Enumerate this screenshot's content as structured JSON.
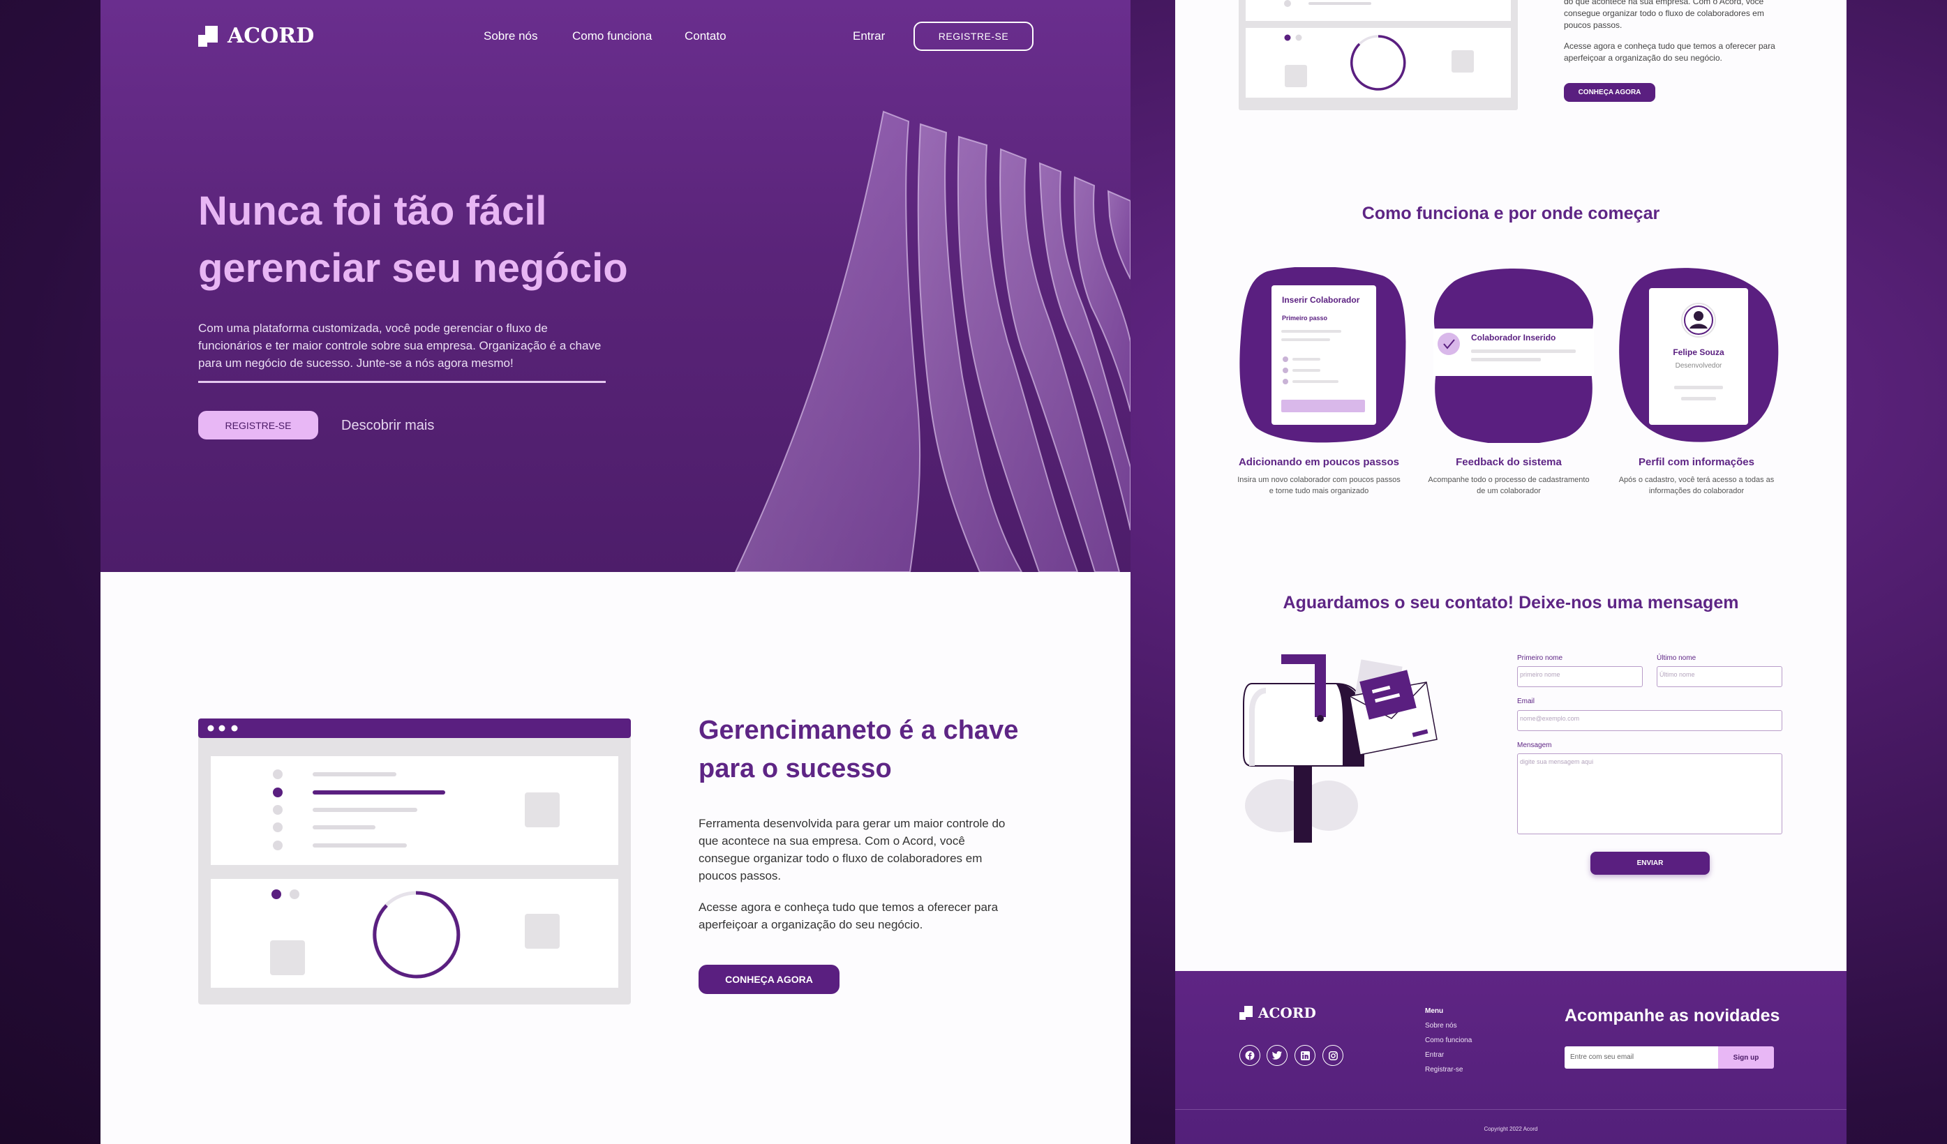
{
  "brand": {
    "name": "ACORD"
  },
  "nav": {
    "links": [
      "Sobre nós",
      "Como funciona",
      "Contato"
    ],
    "login": "Entrar",
    "register": "REGISTRE-SE"
  },
  "hero": {
    "title": "Nunca foi tão fácil gerenciar seu negócio",
    "description": "Com uma plataforma customizada, você pode gerenciar o fluxo de funcionários e ter maior controle sobre sua empresa. Organização é a chave para um negócio de sucesso. Junte-se a nós agora mesmo!",
    "cta": "REGISTRE-SE",
    "more": "Descobrir mais"
  },
  "management": {
    "title": "Gerencimaneto é a chave para o sucesso",
    "paragraph1": "Ferramenta desenvolvida para gerar um maior controle do que acontece na sua empresa. Com o Acord, você consegue organizar todo o fluxo de colaboradores em poucos passos.",
    "paragraph2": "Acesse agora e conheça tudo que temos a oferecer para aperfeiçoar a organização do seu negócio.",
    "cta": "CONHEÇA AGORA"
  },
  "right_top": {
    "paragraph1": "do que acontece na sua empresa. Com o Acord, você consegue organizar todo o fluxo de colaboradores em poucos passos.",
    "paragraph2": "Acesse agora e conheça tudo que temos a oferecer para aperfeiçoar a organização do seu negócio.",
    "cta": "CONHEÇA AGORA"
  },
  "how": {
    "title": "Como funciona e por onde começar",
    "cards": [
      {
        "title": "Adicionando em poucos passos",
        "desc": "Insira um novo colaborador com poucos passos e torne tudo mais organizado",
        "ui_title": "Inserir Colaborador",
        "ui_sub": "Primeiro passo"
      },
      {
        "title": "Feedback do sistema",
        "desc": "Acompanhe todo o processo de cadastramento de um colaborador",
        "ui_title": "Colaborador Inserido"
      },
      {
        "title": "Perfil com informações",
        "desc": "Após o cadastro, você terá acesso a todas as informações do colaborador",
        "ui_name": "Felipe Souza",
        "ui_role": "Desenvolvedor"
      }
    ]
  },
  "contact": {
    "title": "Aguardamos o seu contato! Deixe-nos uma mensagem",
    "first_label": "Primeiro nome",
    "first_placeholder": "primeiro nome",
    "last_label": "Último nome",
    "last_placeholder": "Último nome",
    "email_label": "Email",
    "email_placeholder": "nome@exemplo.com",
    "message_label": "Mensagem",
    "message_placeholder": "digite sua mensagem aqui",
    "send": "ENVIAR"
  },
  "footer": {
    "menu_title": "Menu",
    "menu_items": [
      "Sobre nós",
      "Como funciona",
      "Entrar",
      "Registrar-se"
    ],
    "newsletter_title": "Acompanhe as novidades",
    "newsletter_placeholder": "Entre com seu email",
    "newsletter_button": "Sign up",
    "copyright": "Copyright 2022 Acord",
    "social_icons": [
      "facebook-icon",
      "twitter-icon",
      "linkedin-icon",
      "instagram-icon"
    ]
  },
  "colors": {
    "primary": "#5a1f80",
    "accent": "#e8b7f5",
    "hero_title": "#e8b6f4",
    "background_dark": "#2a0d3e"
  }
}
